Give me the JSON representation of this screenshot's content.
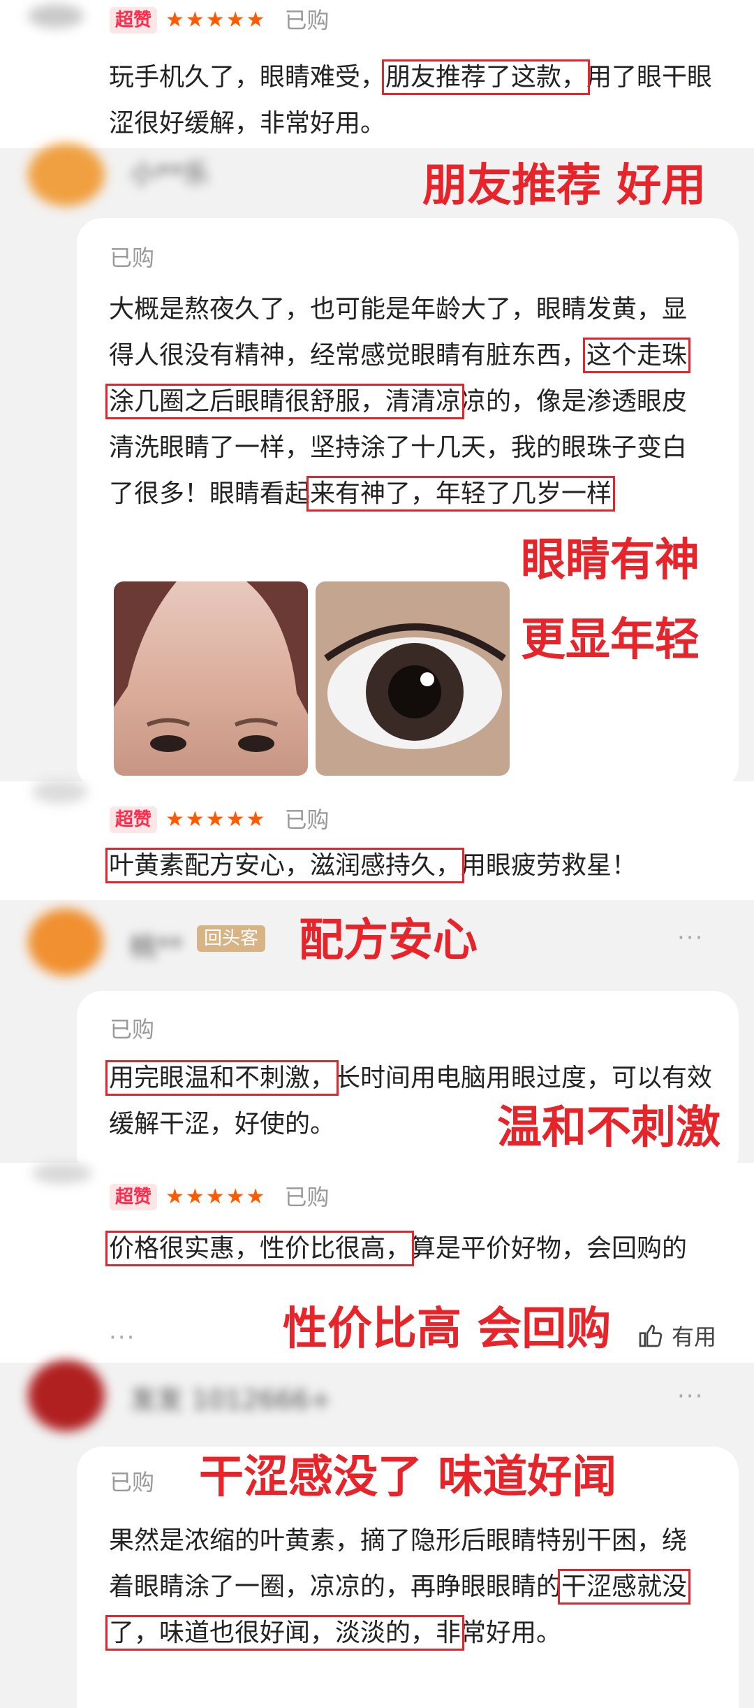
{
  "review1": {
    "badge": "超赞",
    "stars": "★★★★★",
    "status": "已购",
    "text_a": "玩手机久了，眼睛难受，",
    "text_hl": "朋友推荐了这款，",
    "text_b": "用了眼干眼涩很好缓解，非常好用。",
    "annotation": "朋友推荐 好用"
  },
  "review2": {
    "username": "小**乐",
    "status": "已购",
    "text_a": "大概是熬夜久了，也可能是年龄大了，眼睛发黄，显得人很没有精神，经常感觉眼睛有脏东西，",
    "text_hl1": "这个走珠涂几圈之后眼睛很舒服，清清凉",
    "text_b": "凉的，像是渗透眼皮清洗眼睛了一样，坚持涂了十几天，我的眼珠子变白了很多！眼睛看起",
    "text_hl2": "来有神了，年轻了几岁一样",
    "annotation1": "眼睛有神",
    "annotation2": "更显年轻"
  },
  "review3": {
    "badge": "超赞",
    "stars": "★★★★★",
    "status": "已购",
    "text_hl": "叶黄素配方安心，滋润感持久，",
    "text_b": "用眼疲劳救星！"
  },
  "review4": {
    "username": "桃**",
    "repeat_badge": "回头客",
    "menu": "···",
    "annotation_top": "配方安心",
    "status": "已购",
    "text_hl": "用完眼温和不刺激，",
    "text_b": "长时间用电脑用眼过度，可以有效缓解干涩，好使的。",
    "annotation": "温和不刺激"
  },
  "review5": {
    "badge": "超赞",
    "stars": "★★★★★",
    "status": "已购",
    "text_hl": "价格很实惠，性价比很高，",
    "text_b": "算是平价好物，会回购的",
    "more": "···",
    "annotation": "性价比高 会回购",
    "useful": "有用"
  },
  "review6": {
    "username": "发发 1012666+",
    "menu": "···",
    "status": "已购",
    "annotation": "干涩感没了 味道好闻",
    "text_a": "果然是浓缩的叶黄素，摘了隐形后眼睛特别干困，绕着眼睛涂了一圈，凉凉的，再睁眼眼睛的",
    "text_hl": "干涩感就没了，味道也很好闻，淡淡的，非",
    "text_b": "常好用。"
  },
  "colors": {
    "annotation_red": "#e8242b",
    "star_orange": "#ff5a00",
    "badge_pink": "#ff2b4d"
  }
}
